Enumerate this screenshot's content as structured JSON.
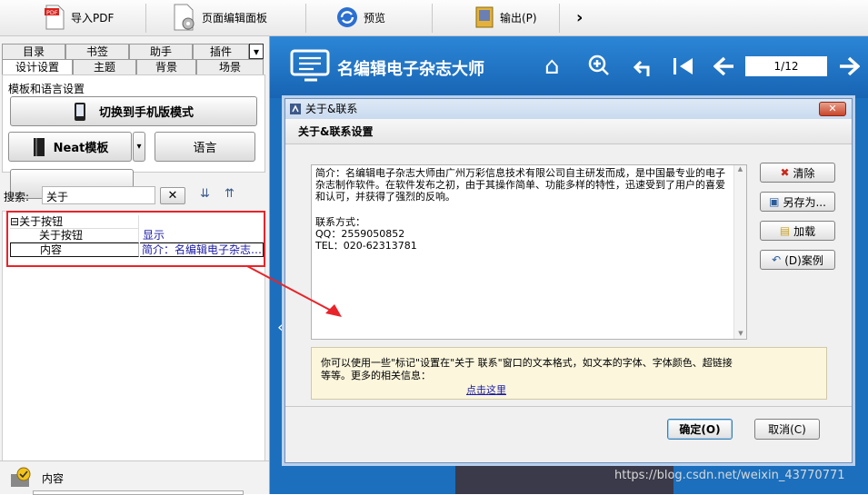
{
  "toolbar": {
    "import_pdf": "导入PDF",
    "page_editor": "页面编辑面板",
    "preview": "预览",
    "output": "输出(P)"
  },
  "left": {
    "tabs_row1": [
      "目录",
      "书签",
      "助手",
      "插件"
    ],
    "tabs_row2": [
      "设计设置",
      "主题",
      "背景",
      "场景"
    ],
    "section_label": "模板和语言设置",
    "switch_mobile": "切换到手机版模式",
    "neat_template": "Neat模板",
    "language": "语言",
    "search_label": "搜索:",
    "search_value": "关于",
    "tree_root": "关于按钮",
    "row1_name": "关于按钮",
    "row1_value": "显示",
    "row2_name": "内容",
    "row2_value": "简介：名编辑电子杂志…",
    "bottom_label": "内容"
  },
  "viewer": {
    "brand": "名编辑电子杂志大师",
    "page_indicator": "1/12"
  },
  "dialog": {
    "title": "关于&联系",
    "header": "关于&联系设置",
    "body_intro": "简介：名编辑电子杂志大师由广州万彩信息技术有限公司自主研发而成，是中国最专业的电子杂志制作软件。在软件发布之初，由于其操作简单、功能多样的特性，迅速受到了用户的喜爱和认可，并获得了强烈的反响。",
    "contact_label": "联系方式：",
    "qq": "QQ：2559050852",
    "tel": "TEL：020-62313781",
    "hint": "你可以使用一些\"标记\"设置在\"关于 联系\"窗口的文本格式，如文本的字体、字体颜色、超链接等等。更多的相关信息：",
    "link": "点击这里",
    "side_buttons": [
      "清除",
      "另存为...",
      "加载",
      "(D)案例"
    ],
    "ok": "确定(O)",
    "cancel": "取消(C)"
  },
  "watermark": "https://blog.csdn.net/weixin_43770771",
  "colors": {
    "accent": "#1b6fbd",
    "highlight": "#e8242a",
    "link": "#1a1aa6"
  }
}
